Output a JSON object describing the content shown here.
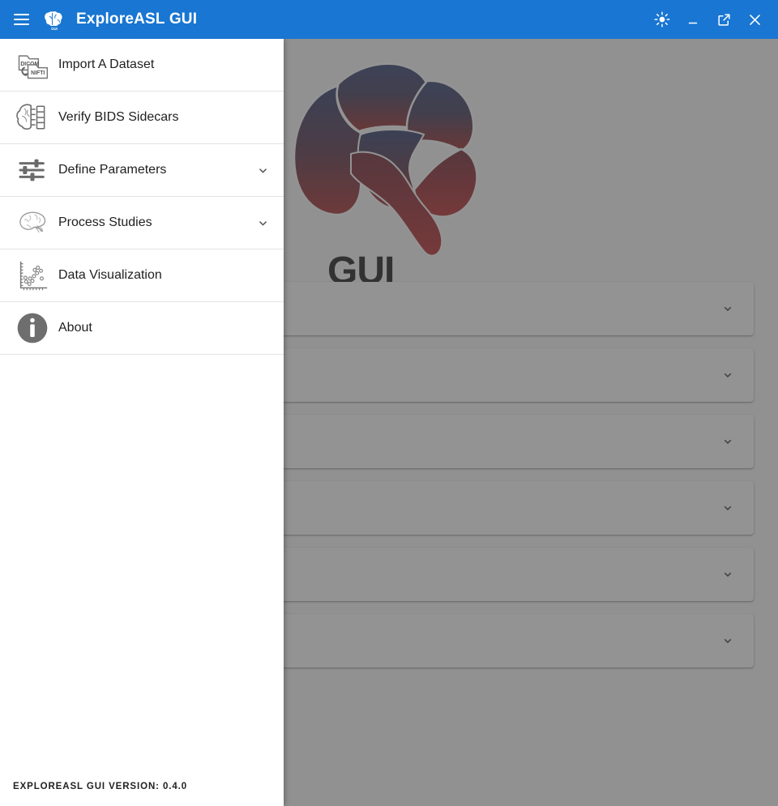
{
  "window": {
    "title": "ExploreASL GUI",
    "app_icon": "brain-gui-icon",
    "menu_icon": "hamburger-menu-icon",
    "controls": [
      {
        "name": "theme-toggle-button",
        "icon": "sun-brightness-icon",
        "label": ""
      },
      {
        "name": "minimize-button",
        "icon": "minimize-icon",
        "label": ""
      },
      {
        "name": "maximize-button",
        "icon": "maximize-external-icon",
        "label": ""
      },
      {
        "name": "close-button",
        "icon": "close-x-icon",
        "label": ""
      }
    ],
    "titlebar_color": "#1976d2",
    "titlebar_text_color": "#ffffff"
  },
  "drawer": {
    "open": true,
    "items": [
      {
        "label": "Import A Dataset",
        "icon": "dicom-to-nifti-folders-icon",
        "expandable": false
      },
      {
        "label": "Verify BIDS Sidecars",
        "icon": "brain-bids-files-icon",
        "expandable": false
      },
      {
        "label": "Define Parameters",
        "icon": "sliders-settings-icon",
        "expandable": true
      },
      {
        "label": "Process Studies",
        "icon": "brain-sketch-icon",
        "expandable": true
      },
      {
        "label": "Data Visualization",
        "icon": "scatter-plot-icon",
        "expandable": false
      },
      {
        "label": "About",
        "icon": "info-circle-icon",
        "expandable": false
      }
    ],
    "footer": {
      "version_text": "EXPLOREASL GUI VERSION: 0.4.0"
    },
    "chevron_icon": "chevron-down-icon"
  },
  "main": {
    "logo": {
      "name": "exploreasl-brain-logo",
      "gui_text": "GUI",
      "color_blue": "#1f3061",
      "color_red": "#8c1111"
    },
    "panels": [
      {
        "title": "",
        "chevron": "chevron-down-icon"
      },
      {
        "title": "",
        "chevron": "chevron-down-icon"
      },
      {
        "title": "",
        "chevron": "chevron-down-icon"
      },
      {
        "title": "",
        "chevron": "chevron-down-icon"
      },
      {
        "title": "",
        "chevron": "chevron-down-icon"
      },
      {
        "title": "",
        "chevron": "chevron-down-icon"
      }
    ],
    "scrim_color": "#505050"
  }
}
